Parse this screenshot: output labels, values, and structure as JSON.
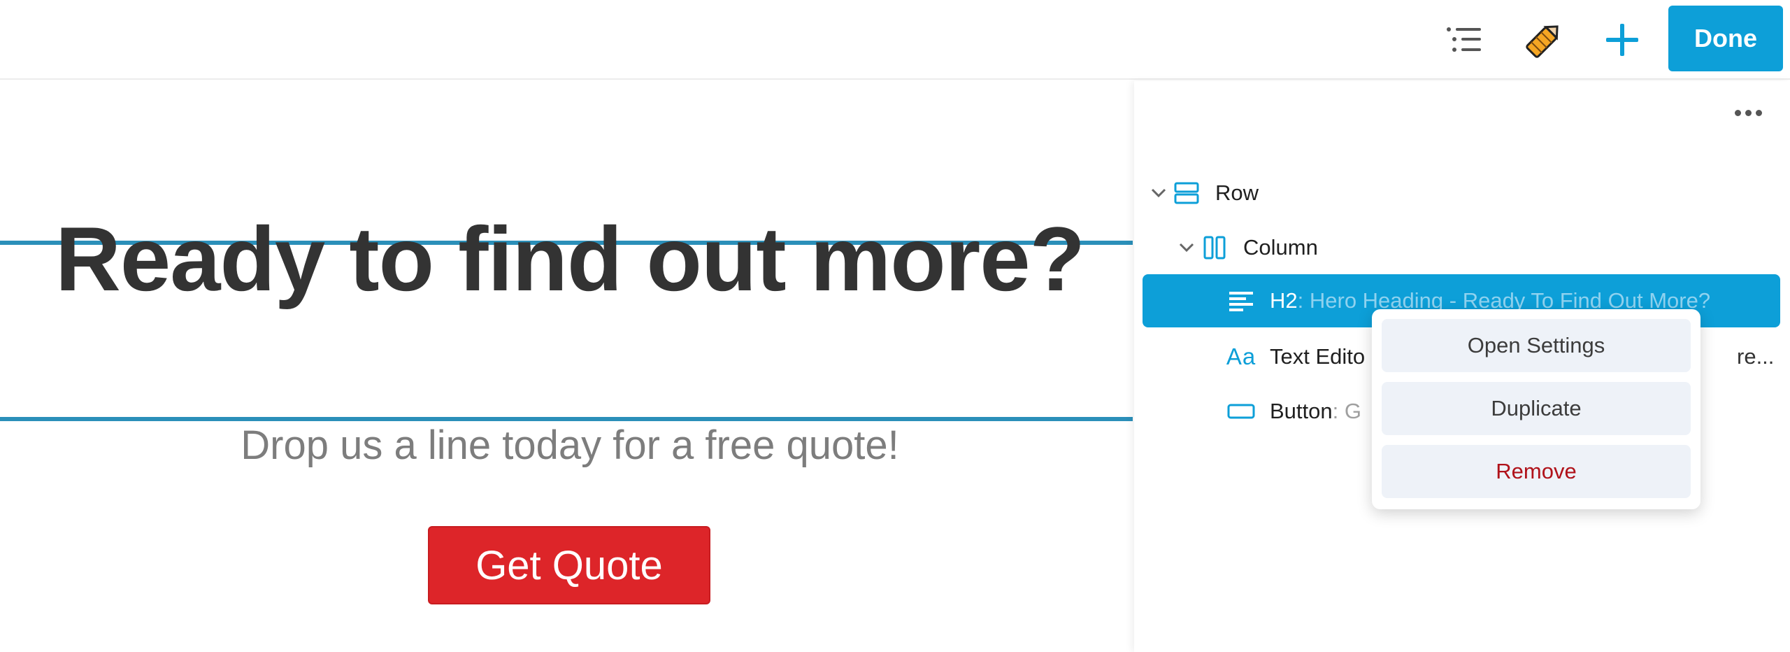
{
  "toolbar": {
    "outline_icon": "list-outline-icon",
    "pencil_icon": "pencil-icon",
    "add_icon": "plus-icon",
    "done_label": "Done",
    "accent_color": "#0d9fd8"
  },
  "canvas": {
    "heading": "Ready to find out more?",
    "subtext": "Drop us a line today for a free quote!",
    "button_label": "Get Quote",
    "button_color": "#dd2529"
  },
  "panel": {
    "more_icon": "ellipsis-icon",
    "tree": [
      {
        "label": "Row",
        "desc": "",
        "icon": "row-icon",
        "expanded": true
      },
      {
        "label": "Column",
        "desc": "",
        "icon": "column-icon",
        "expanded": true
      },
      {
        "label": "H2",
        "desc": ": Hero Heading - Ready To Find Out More?",
        "icon": "heading-icon",
        "selected": true
      },
      {
        "label": "Text Edito",
        "desc": "re...",
        "icon": "text-editor-icon"
      },
      {
        "label": "Button",
        "desc": ": G",
        "icon": "button-icon"
      }
    ]
  },
  "context_menu": {
    "items": [
      {
        "label": "Open Settings"
      },
      {
        "label": "Duplicate"
      },
      {
        "label": "Remove",
        "danger": true
      }
    ]
  }
}
